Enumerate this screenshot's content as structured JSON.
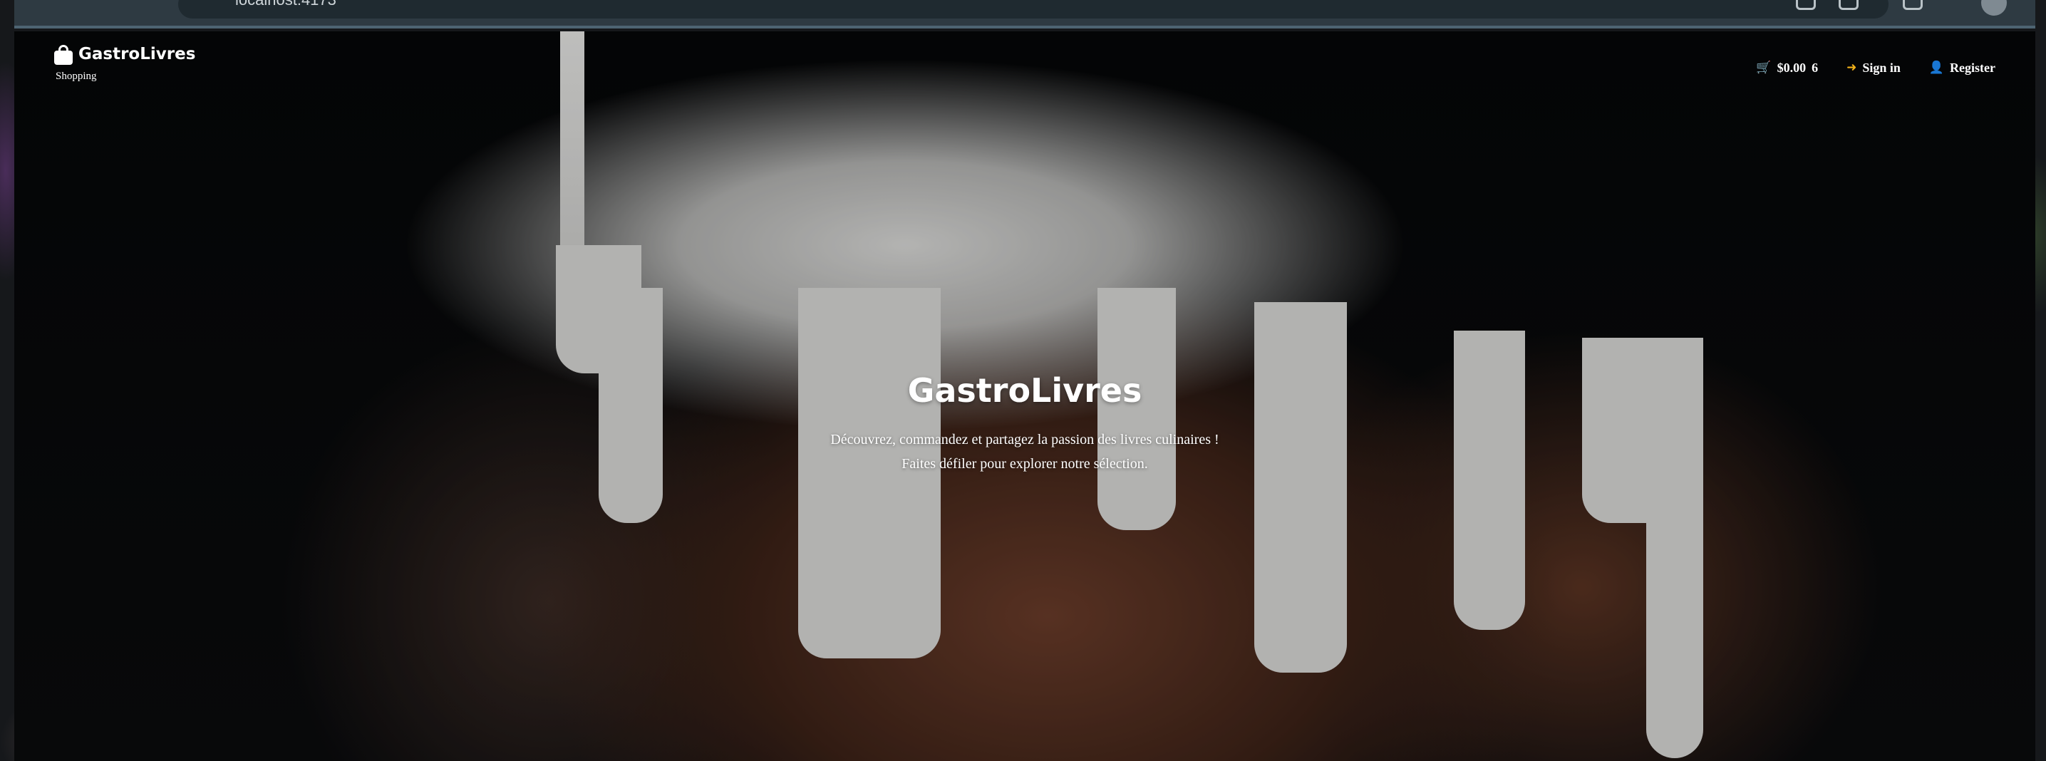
{
  "browser": {
    "url": "localhost:4173"
  },
  "navbar": {
    "brand": "GastroLivres",
    "subtitle": "Shopping",
    "cart": {
      "icon": "cart-icon",
      "total": "$0.00",
      "count": "6"
    },
    "sign_in": {
      "icon": "sign-in-icon",
      "label": "Sign in"
    },
    "register": {
      "icon": "user-plus-icon",
      "label": "Register"
    }
  },
  "hero": {
    "title": "GastroLivres",
    "line1": "Découvrez, commandez et partagez la passion des livres culinaires !",
    "line2": "Faites défiler pour explorer notre sélection."
  },
  "colors": {
    "accent_icon": "#f3b21a",
    "text": "#ffffff",
    "page_bg": "#050608"
  }
}
